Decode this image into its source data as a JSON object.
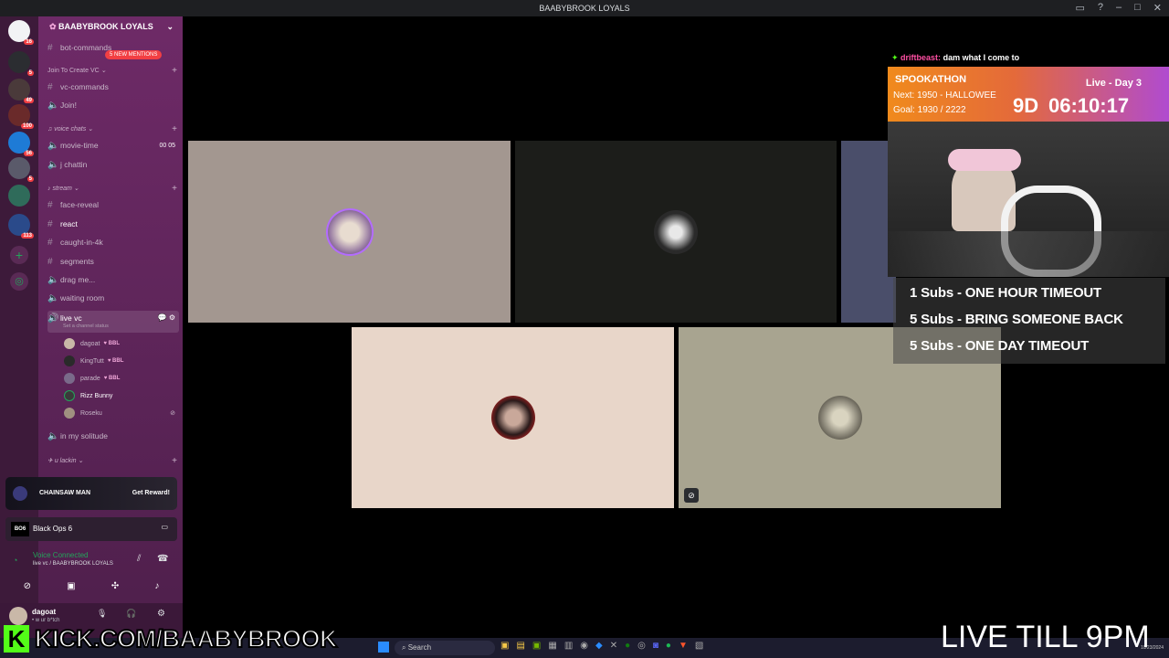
{
  "window": {
    "title": "BAABYBROOK LOYALS"
  },
  "rail": {
    "badges": [
      "16",
      "5",
      "49",
      "100",
      "56",
      "5",
      "113"
    ]
  },
  "guild": {
    "name": "BAABYBROOK LOYALS",
    "mentions_pill": "5 NEW MENTIONS"
  },
  "channels": {
    "bot_commands": "bot-commands",
    "cat_join": "Join To Create VC",
    "vc_commands": "vc-commands",
    "join": "Join!",
    "cat_voice": "voice chats",
    "movie_time": "movie-time",
    "movie_time_count": "00  05",
    "j_chattin": "j chattin",
    "cat_stream": "stream",
    "face_reveal": "face-reveal",
    "react": "react",
    "caught_in_4k": "caught-in-4k",
    "segments": "segments",
    "drag_me": "drag me...",
    "waiting_room": "waiting room",
    "live_vc": "live vc",
    "live_vc_status": "Set a channel status",
    "in_my_solitude": "in my solitude",
    "cat_lackin": "u lackin"
  },
  "members": [
    {
      "name": "dagoat",
      "tag": "BBL"
    },
    {
      "name": "KingTutt",
      "tag": "BBL"
    },
    {
      "name": "parade",
      "tag": "BBL"
    },
    {
      "name": "Rizz Bunny",
      "tag": ""
    },
    {
      "name": "Roseku",
      "tag": ""
    }
  ],
  "promo": {
    "title": "CHAINSAW MAN",
    "button": "Get Reward!"
  },
  "activity": {
    "badge": "BO6",
    "game": "Black Ops 6"
  },
  "voice": {
    "status": "Voice Connected",
    "channel": "live vc / BAABYBROOK LOYALS"
  },
  "user": {
    "name": "dagoat",
    "status": "• w ur b*tch"
  },
  "overlay": {
    "chat_user": "driftbeast:",
    "chat_msg": "dam what I come to",
    "subathon_title": "SPOOKATHON",
    "subathon_next": "Next: 1950 - HALLOWEE",
    "subathon_goal": "Goal: 1930 / 2222",
    "live_day": "Live - Day 3",
    "timer_days": "9D",
    "timer_clock": "06:10:17",
    "subs": [
      "1 Subs - ONE HOUR TIMEOUT",
      "5 Subs - BRING SOMEONE BACK",
      "5 Subs - ONE DAY TIMEOUT"
    ],
    "kick_url": "KICK.COM/BAABYBROOK",
    "live_till": "LIVE TILL 9PM"
  },
  "taskbar": {
    "search": "Search",
    "date": "10/23/2024"
  }
}
